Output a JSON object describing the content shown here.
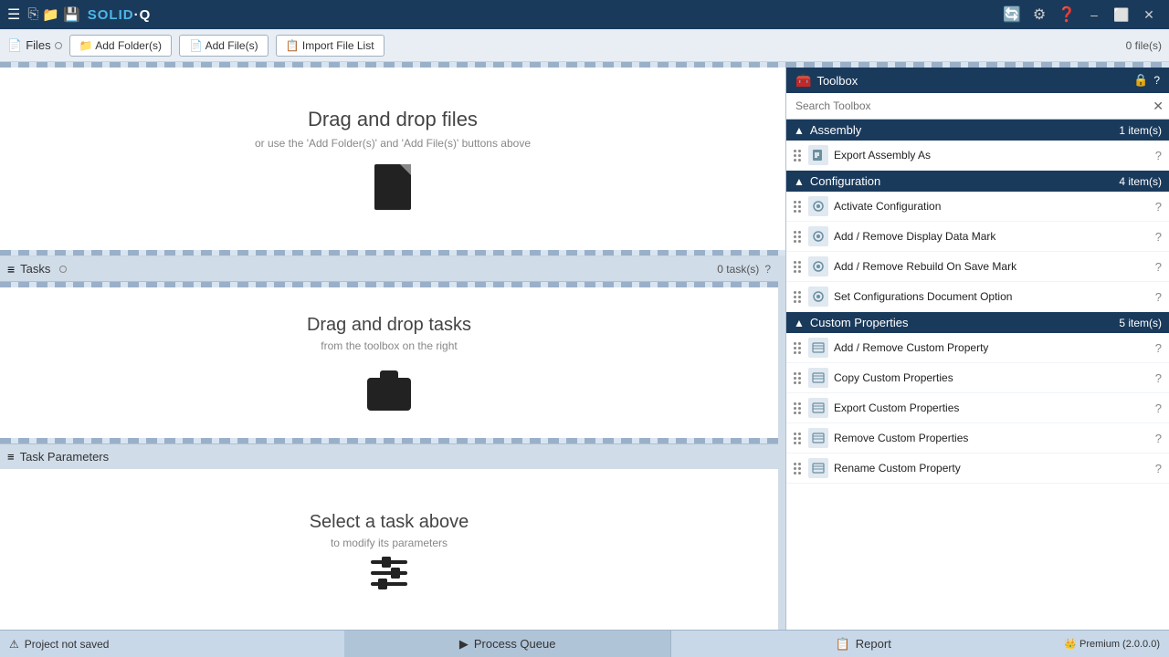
{
  "titlebar": {
    "logo": "SOLID·Q",
    "logo_color": "SOLID·",
    "logo_accent": "Q",
    "win_min": "–",
    "win_restore": "⬜",
    "win_close": "✕"
  },
  "toolbar": {
    "files_label": "Files",
    "add_folder_btn": "Add Folder(s)",
    "add_file_btn": "Add File(s)",
    "import_list_btn": "Import File List",
    "file_count": "0 file(s)"
  },
  "files_drop": {
    "title": "Drag and drop files",
    "subtitle": "or use the 'Add Folder(s)' and 'Add File(s)' buttons above"
  },
  "tasks": {
    "header_label": "Tasks",
    "task_count": "0 task(s)",
    "drop_title": "Drag and drop tasks",
    "drop_subtitle": "from the toolbox on the right"
  },
  "task_params": {
    "header_label": "Task Parameters",
    "select_title": "Select a task above",
    "select_subtitle": "to modify its parameters"
  },
  "toolbox": {
    "title": "Toolbox",
    "search_placeholder": "Search Toolbox",
    "sections": [
      {
        "id": "assembly",
        "label": "Assembly",
        "count": "1 item(s)",
        "expanded": true,
        "items": [
          {
            "label": "Export Assembly As",
            "icon": "file-export"
          }
        ]
      },
      {
        "id": "configuration",
        "label": "Configuration",
        "count": "4 item(s)",
        "expanded": true,
        "items": [
          {
            "label": "Activate Configuration",
            "icon": "gear"
          },
          {
            "label": "Add / Remove Display Data Mark",
            "icon": "gear"
          },
          {
            "label": "Add / Remove Rebuild On Save Mark",
            "icon": "gear"
          },
          {
            "label": "Set Configurations Document Option",
            "icon": "gear"
          }
        ]
      },
      {
        "id": "custom_properties",
        "label": "Custom Properties",
        "count": "5 item(s)",
        "expanded": true,
        "items": [
          {
            "label": "Add / Remove Custom Property",
            "icon": "list"
          },
          {
            "label": "Copy Custom Properties",
            "icon": "list"
          },
          {
            "label": "Export Custom Properties",
            "icon": "list"
          },
          {
            "label": "Remove Custom Properties",
            "icon": "list"
          },
          {
            "label": "Rename Custom Property",
            "icon": "list"
          }
        ]
      }
    ]
  },
  "statusbar": {
    "project_not_saved": "Project not saved",
    "process_queue": "Process Queue",
    "report": "Report",
    "premium": "Premium (2.0.0.0)"
  }
}
